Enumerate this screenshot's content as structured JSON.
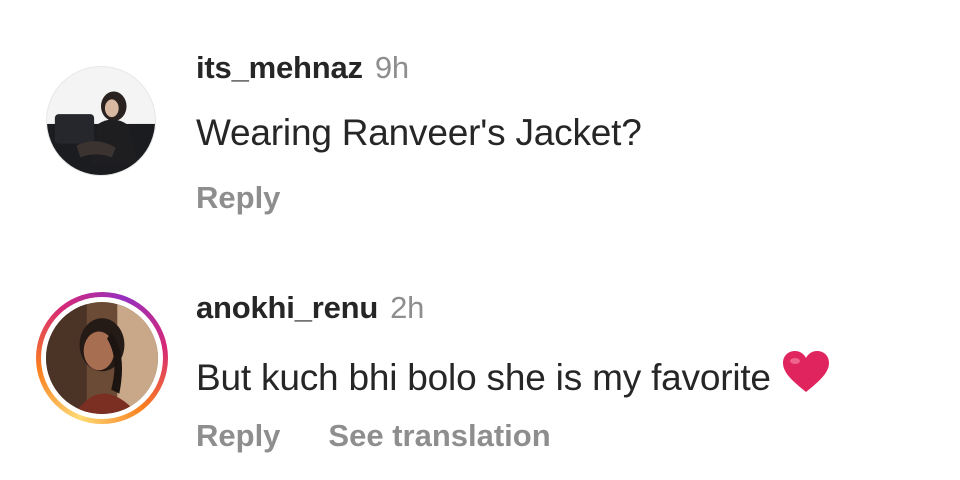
{
  "comments": [
    {
      "username": "its_mehnaz",
      "time": "9h",
      "text": "Wearing Ranveer's Jacket?",
      "reply_label": "Reply",
      "avatar_icon": "profile-photo-woman-on-sofa",
      "has_story_ring": false
    },
    {
      "username": "anokhi_renu",
      "time": "2h",
      "text": "But kuch bhi bolo she is my favorite",
      "emoji": "heart-icon",
      "reply_label": "Reply",
      "translation_label": "See translation",
      "avatar_icon": "profile-photo-woman-portrait",
      "has_story_ring": true,
      "colors": {
        "heart": "#e0245e",
        "ring": [
          "#feda75",
          "#fa7e1e",
          "#d62976",
          "#962fbf"
        ]
      }
    }
  ]
}
